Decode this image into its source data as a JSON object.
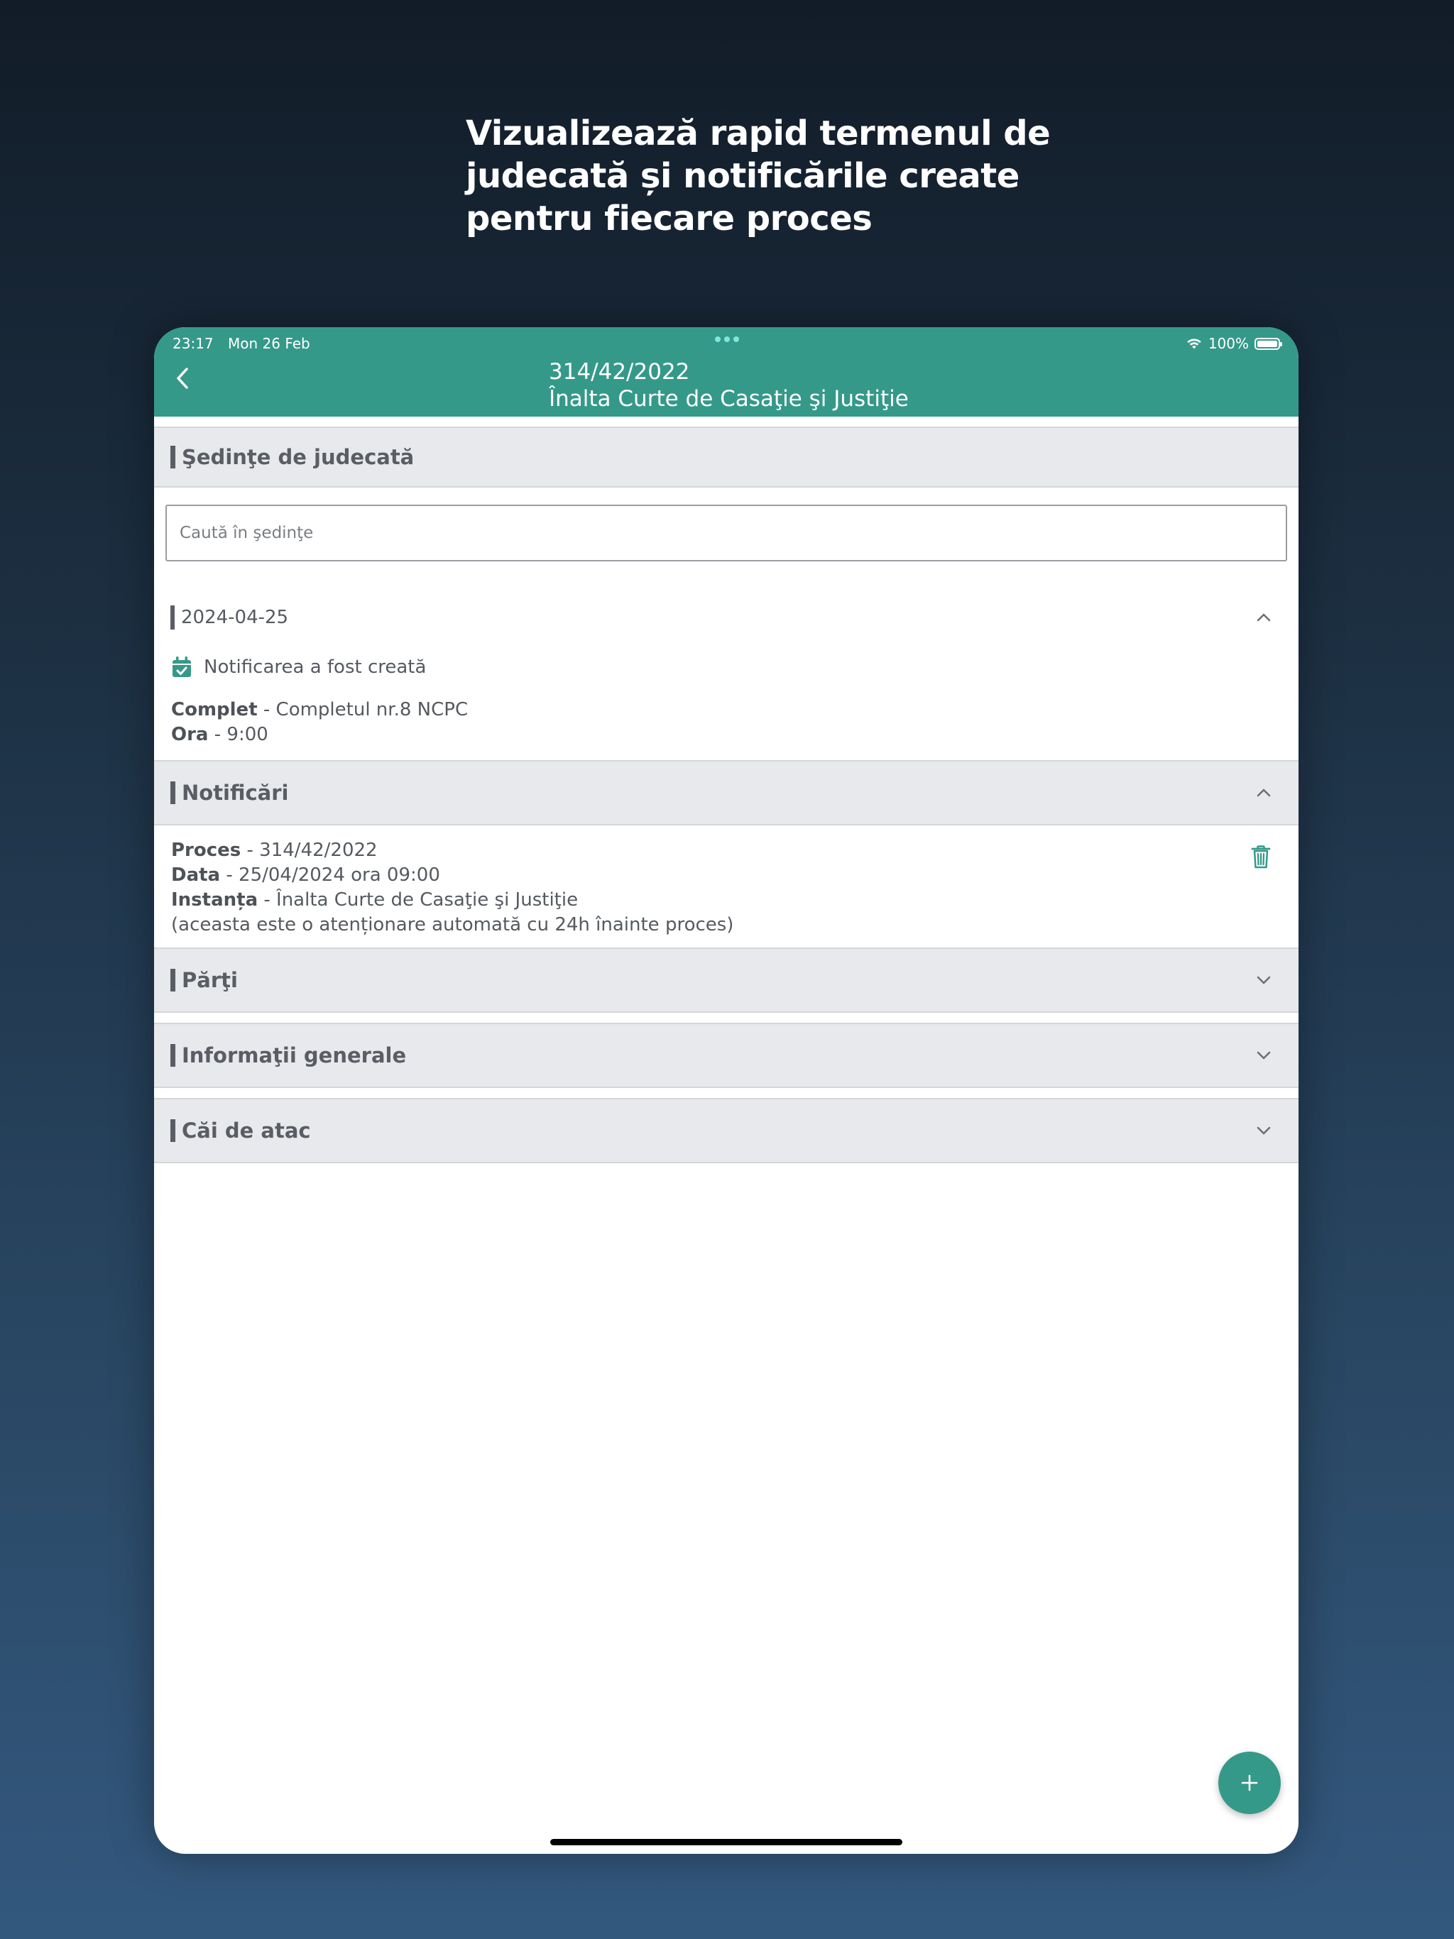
{
  "promo": {
    "line1": "Vizualizează rapid termenul de",
    "line2": "judecată și notificările create",
    "line3": "pentru fiecare proces"
  },
  "status_bar": {
    "time": "23:17",
    "date": "Mon 26 Feb",
    "battery": "100%"
  },
  "nav": {
    "title_line1": "314/42/2022",
    "title_line2": "Înalta Curte de Casaţie şi Justiţie"
  },
  "sedinte": {
    "header": "Şedinţe de judecată",
    "search_placeholder": "Caută în şedinţe",
    "session": {
      "date": "2024-04-25",
      "notification_created": "Notificarea a fost creată",
      "complet_label": "Complet",
      "complet_value": " - Completul nr.8 NCPC",
      "ora_label": "Ora",
      "ora_value": " - 9:00"
    }
  },
  "notificari": {
    "header": "Notificări",
    "item": {
      "proces_label": "Proces",
      "proces_value": " - 314/42/2022",
      "data_label": "Data",
      "data_value": " - 25/04/2024 ora 09:00",
      "instanta_label": "Instanța",
      "instanta_value": " - Înalta Curte de Casaţie şi Justiţie",
      "note": "(aceasta este o atenționare automată cu 24h înainte proces)"
    }
  },
  "parti": {
    "header": "Părţi"
  },
  "informatii": {
    "header": "Informaţii generale"
  },
  "cai_atac": {
    "header": "Căi de atac"
  },
  "colors": {
    "accent": "#359989",
    "section_bg": "#e8e9ed",
    "text": "#555a60"
  },
  "icons": {
    "back": "chevron-left-icon",
    "calendar": "calendar-check-icon",
    "trash": "trash-icon",
    "add": "plus-icon",
    "expand": "chevron-down-icon",
    "collapse": "chevron-up-icon"
  }
}
